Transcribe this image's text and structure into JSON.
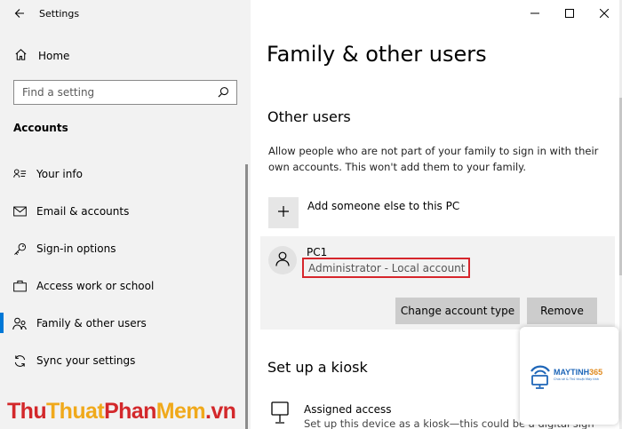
{
  "app": {
    "title": "Settings"
  },
  "sidebar": {
    "home_label": "Home",
    "search_placeholder": "Find a setting",
    "section_heading": "Accounts",
    "items": [
      {
        "label": "Your info",
        "icon": "person-card-icon"
      },
      {
        "label": "Email & accounts",
        "icon": "envelope-icon"
      },
      {
        "label": "Sign-in options",
        "icon": "key-icon"
      },
      {
        "label": "Access work or school",
        "icon": "briefcase-icon"
      },
      {
        "label": "Family & other users",
        "icon": "family-users-icon",
        "active": true
      },
      {
        "label": "Sync your settings",
        "icon": "sync-icon"
      }
    ]
  },
  "main": {
    "page_title": "Family & other users",
    "other_users": {
      "heading": "Other users",
      "description": "Allow people who are not part of your family to sign in with their own accounts. This won't add them to your family.",
      "add_label": "Add someone else to this PC",
      "user": {
        "name": "PC1",
        "role": "Administrator - Local account",
        "change_button": "Change account type",
        "remove_button": "Remove"
      }
    },
    "kiosk": {
      "heading": "Set up a kiosk",
      "item_title": "Assigned access",
      "item_desc": "Set up this device as a kiosk—this could be a digital sign"
    }
  },
  "watermark": {
    "part1": "Thu",
    "part2": "Thuat",
    "part3": "Phan",
    "part4": "Mem",
    "part5": ".vn"
  },
  "logo": {
    "brand_a": "MAYTINH",
    "brand_b": "365",
    "tagline": "Chia sẻ & Thủ thuật Máy tính"
  },
  "colors": {
    "accent": "#0078d7",
    "highlight_box": "#d6262c",
    "sidebar_bg": "#f2f2f2",
    "button_bg": "#cccccc"
  }
}
